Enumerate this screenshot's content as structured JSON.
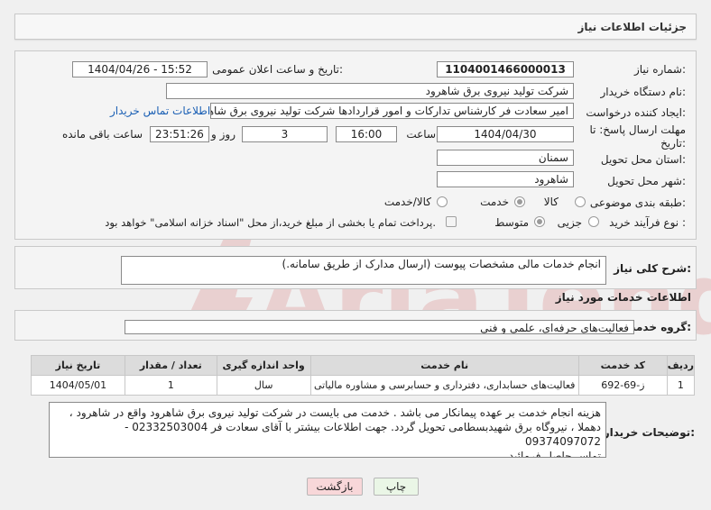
{
  "header": {
    "title": "جزئیات اطلاعات نیاز"
  },
  "need_number": {
    "label": "شماره نیاز:",
    "value": "1104001466000013"
  },
  "announce_date": {
    "label": "تاریخ و ساعت اعلان عمومی:",
    "value": "1404/04/26 - 15:52"
  },
  "buyer_org": {
    "label": "نام دستگاه خریدار:",
    "value": "شرکت تولید نیروی برق شاهرود"
  },
  "requester": {
    "label": "ایجاد کننده درخواست:",
    "value": "امیر سعادت فر کارشناس تدارکات و امور قراردادها شرکت تولید نیروی برق شاهرود",
    "contact_link": "اطلاعات تماس خریدار"
  },
  "deadline": {
    "label": "مهلت ارسال پاسخ: تا تاریخ:",
    "date": "1404/04/30",
    "time_label": "ساعت",
    "time": "16:00",
    "days": "3",
    "days_label": "روز و",
    "remaining": "23:51:26",
    "remaining_label": "ساعت باقی مانده"
  },
  "province": {
    "label": "استان محل تحویل:",
    "value": "سمنان"
  },
  "city": {
    "label": "شهر محل تحویل:",
    "value": "شاهرود"
  },
  "category": {
    "label": "طبقه بندی موضوعی:",
    "options": [
      "کالا",
      "خدمت",
      "کالا/خدمت"
    ],
    "selected": "خدمت"
  },
  "purchase_type": {
    "label": "نوع فرآیند خرید :",
    "options": [
      "جزیی",
      "متوسط"
    ],
    "selected": "متوسط",
    "treasury_note": "پرداخت تمام یا بخشی از مبلغ خرید،از محل \"اسناد خزانه اسلامی\" خواهد بود."
  },
  "description": {
    "label": "شرح کلی نیاز:",
    "value": "انجام خدمات مالی مشخصات پیوست (ارسال مدارک از طریق سامانه.)"
  },
  "services_info": {
    "title": "اطلاعات خدمات مورد نیاز"
  },
  "service_group": {
    "label": "گروه خدمت:",
    "value": "فعالیت‌های حرفه‌ای، علمی و فنی"
  },
  "table": {
    "headers": [
      "ردیف",
      "کد خدمت",
      "نام خدمت",
      "واحد اندازه گیری",
      "تعداد / مقدار",
      "تاریخ نیاز"
    ],
    "rows": [
      [
        "1",
        "ز-69-692",
        "فعالیت‌های حسابداری، دفترداری و حسابرسی و مشاوره مالیاتی",
        "سال",
        "1",
        "1404/05/01"
      ]
    ]
  },
  "buyer_notes": {
    "label": "توضیحات خریدار:",
    "lines": [
      "هزینه انجام خدمت بر عهده پیمانکار می باشد . خدمت می بایست در شرکت تولید نیروی برق شاهرود واقع در شاهرود ،",
      "دهملا ، نیروگاه برق شهیدبسطامی تحویل گردد. جهت اطلاعات بیشتر با آقای سعادت فر  02332503004 - 09374097072",
      "تماس حاصل فرمائید."
    ]
  },
  "buttons": {
    "print": "چاپ",
    "back": "بازگشت"
  },
  "watermark_text": "AriaTender.neT",
  "colors": {
    "back_button": "#f8d7d9",
    "print_button": "#eaf6e6",
    "link": "#1a5fb4"
  }
}
